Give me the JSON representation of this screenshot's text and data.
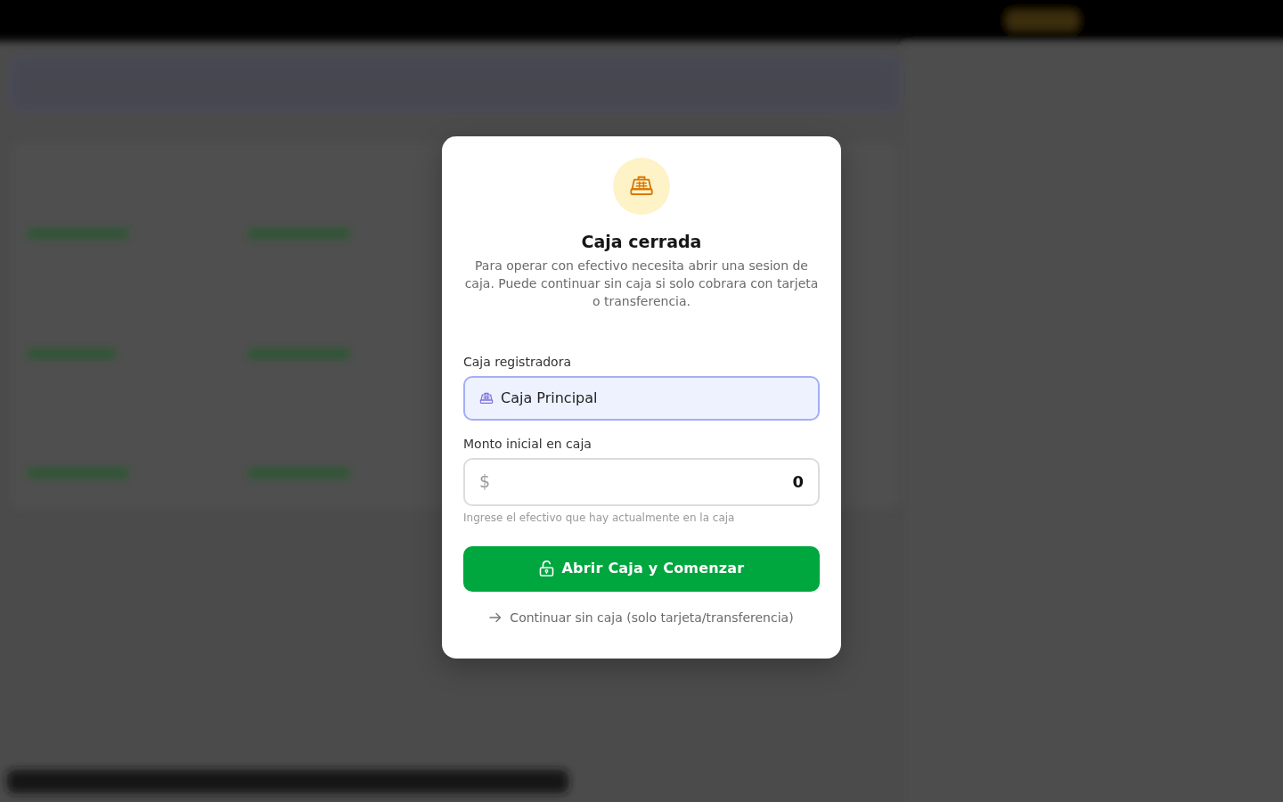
{
  "modal": {
    "title": "Caja cerrada",
    "description": "Para operar con efectivo necesita abrir una sesion de caja. Puede continuar sin caja si solo cobrara con tarjeta o transferencia.",
    "register_field": {
      "label": "Caja registradora",
      "value": "Caja Principal"
    },
    "amount_field": {
      "label": "Monto inicial en caja",
      "prefix": "$",
      "value": "0",
      "hint": "Ingrese el efectivo que hay actualmente en la caja"
    },
    "primary_button": {
      "label": "Abrir Caja y Comenzar"
    },
    "secondary_link": {
      "label": "Continuar sin caja (solo tarjeta/transferencia)"
    }
  }
}
